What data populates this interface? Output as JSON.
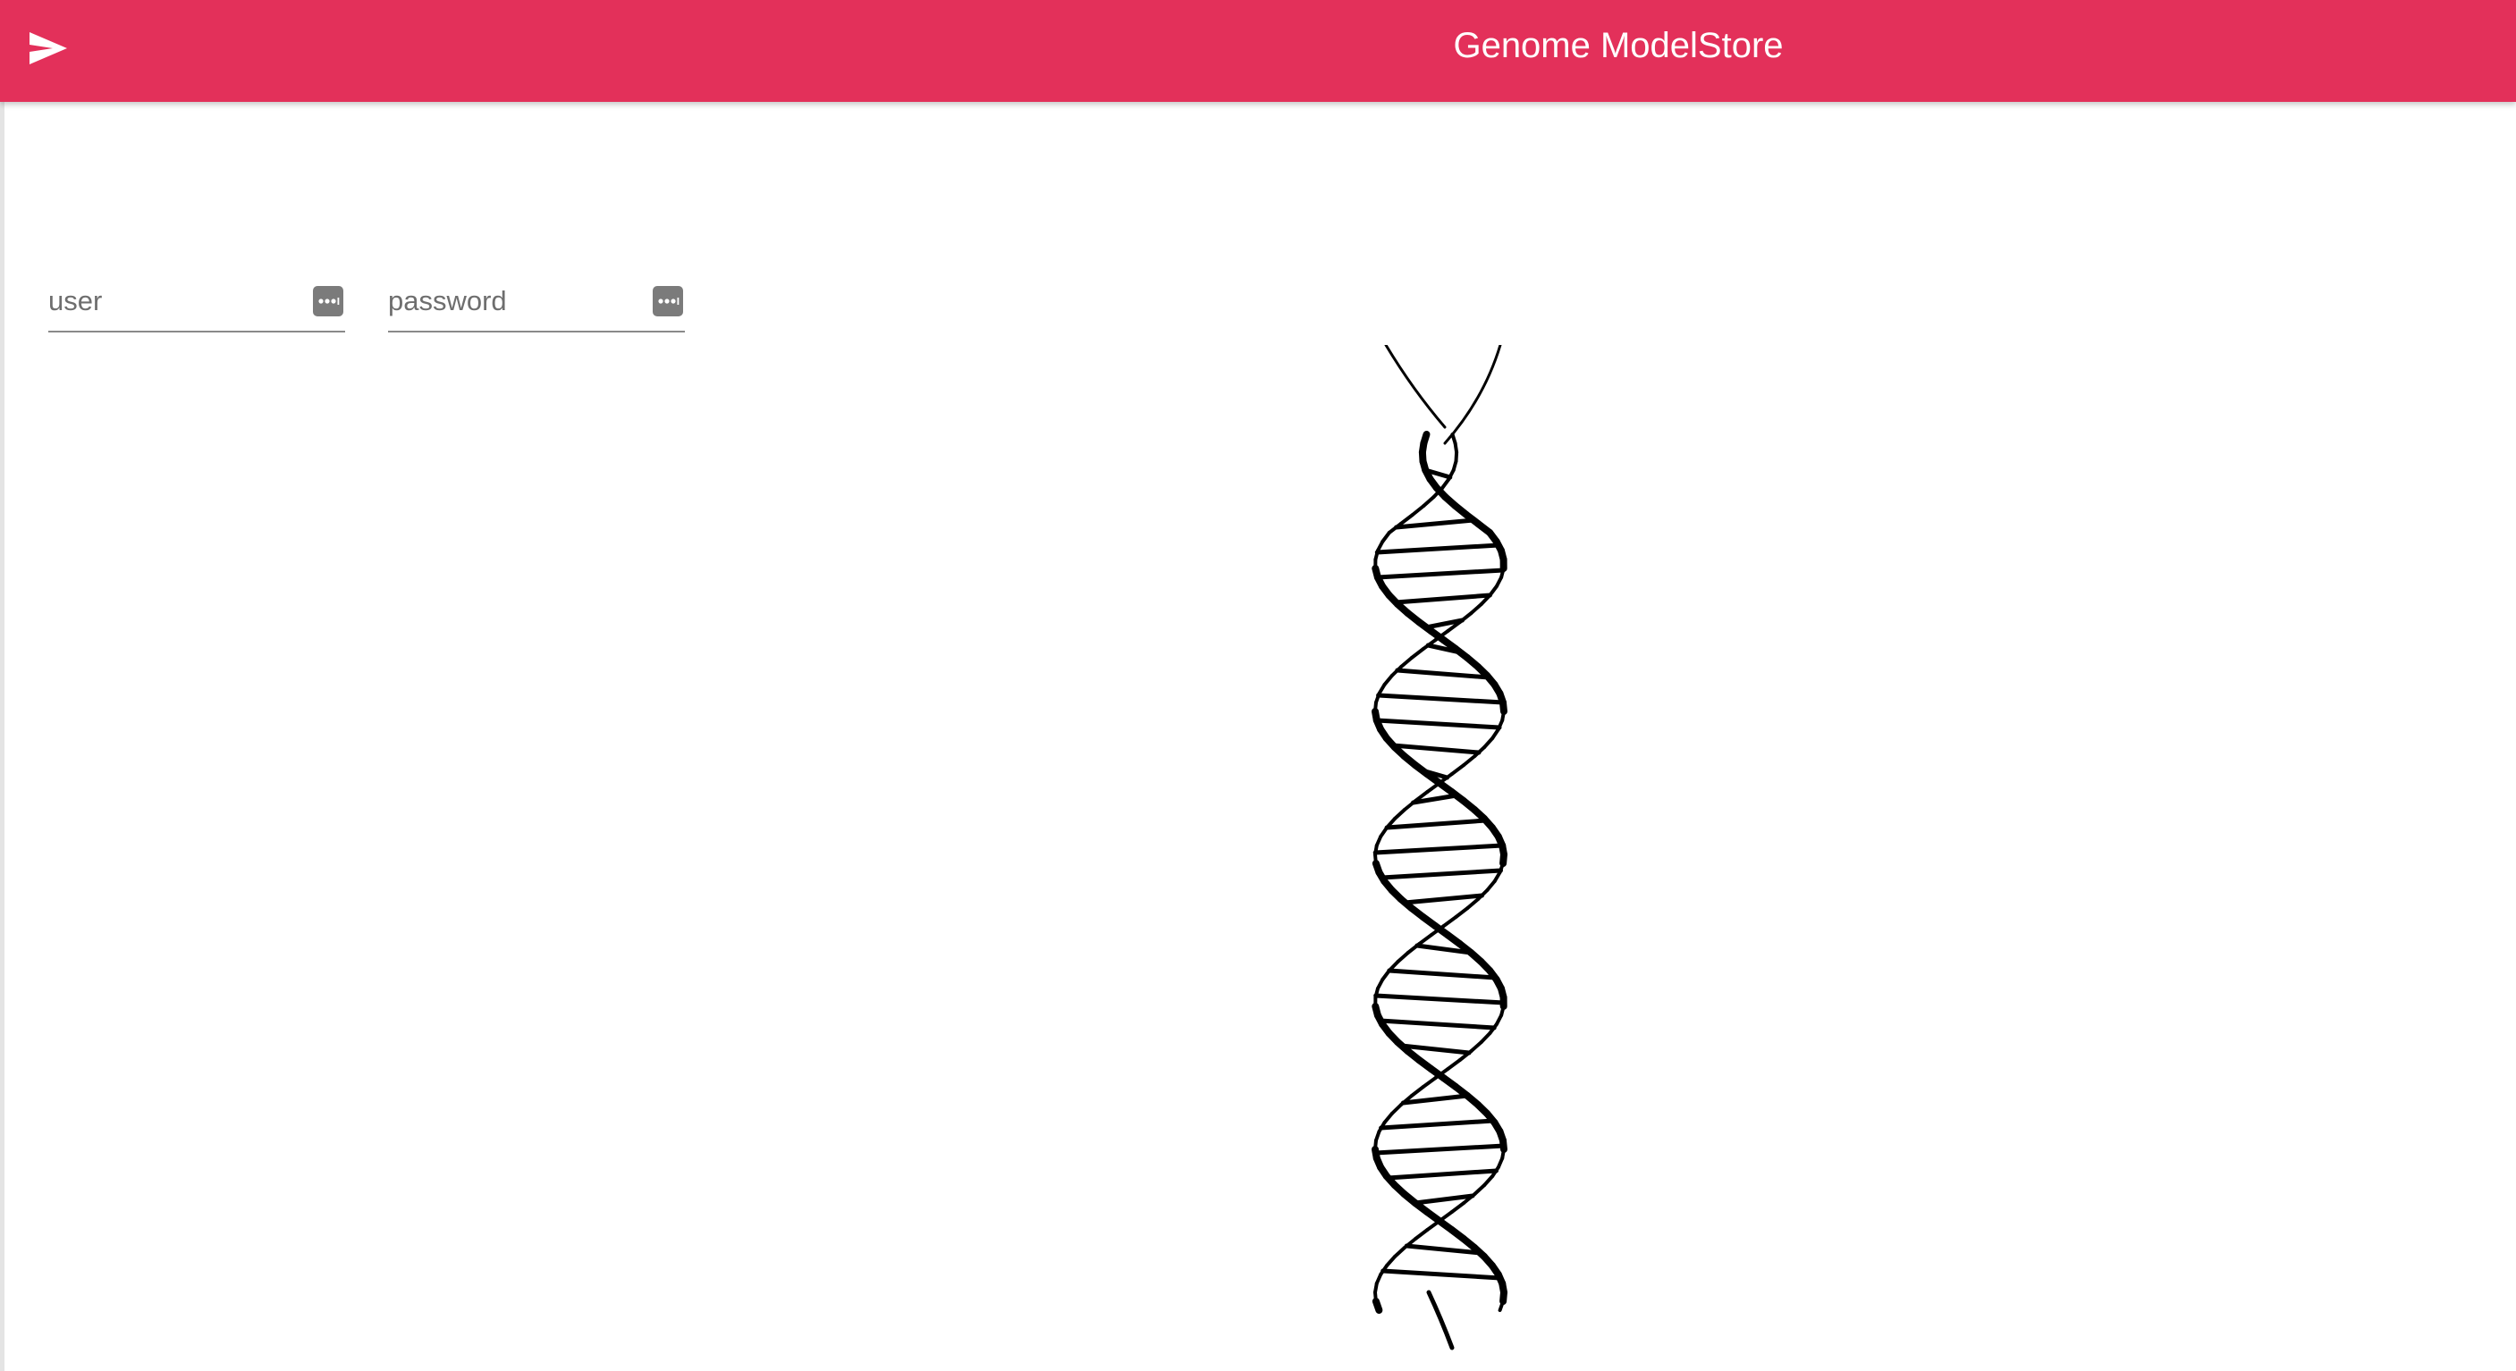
{
  "app_bar": {
    "title": "Genome ModelStore",
    "background_color": "#e3305a",
    "send_icon": "send-icon"
  },
  "login": {
    "user": {
      "placeholder": "user",
      "value": "",
      "icon": "password-manager-icon"
    },
    "password": {
      "placeholder": "password",
      "value": "",
      "icon": "password-manager-icon"
    }
  },
  "illustration": {
    "subject": "dna-double-helix"
  }
}
